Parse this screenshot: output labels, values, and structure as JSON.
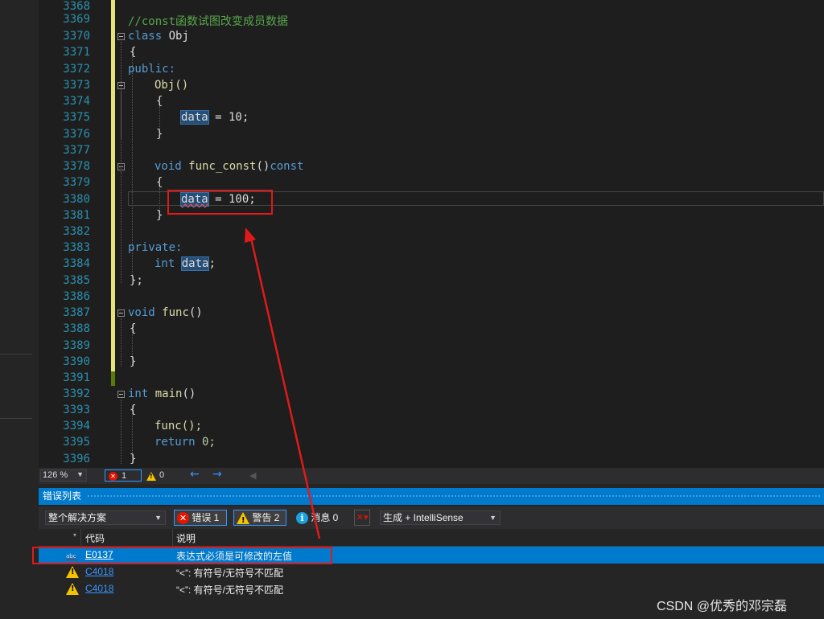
{
  "editor": {
    "lines": [
      {
        "n": "3368"
      },
      {
        "n": "3369"
      },
      {
        "n": "3370"
      },
      {
        "n": "3371"
      },
      {
        "n": "3372"
      },
      {
        "n": "3373"
      },
      {
        "n": "3374"
      },
      {
        "n": "3375"
      },
      {
        "n": "3376"
      },
      {
        "n": "3377"
      },
      {
        "n": "3378"
      },
      {
        "n": "3379"
      },
      {
        "n": "3380"
      },
      {
        "n": "3381"
      },
      {
        "n": "3382"
      },
      {
        "n": "3383"
      },
      {
        "n": "3384"
      },
      {
        "n": "3385"
      },
      {
        "n": "3386"
      },
      {
        "n": "3387"
      },
      {
        "n": "3388"
      },
      {
        "n": "3389"
      },
      {
        "n": "3390"
      },
      {
        "n": "3391"
      },
      {
        "n": "3392"
      },
      {
        "n": "3393"
      },
      {
        "n": "3394"
      },
      {
        "n": "3395"
      },
      {
        "n": "3396"
      }
    ],
    "code": {
      "comment": "//const函数试图改变成员数据",
      "class_kw": "class",
      "class_name": "Obj",
      "open_brace": "{",
      "close_brace": "}",
      "class_end": "};",
      "public_label": "public:",
      "private_label": "private:",
      "ctor": "Obj()",
      "data_ident": "data",
      "assign_10": " = 10;",
      "void_kw": "void",
      "func_const_name": "func_const",
      "parens": "()",
      "const_kw": "const",
      "assign_100": " = 100;",
      "int_kw": "int",
      "semicolon": ";",
      "func_name": "func",
      "main_name": "main",
      "func_call": "func();",
      "return_kw": "return",
      "return_val": " 0;"
    }
  },
  "statusbar": {
    "zoom": "126 %",
    "error_count": "1",
    "warning_count": "0"
  },
  "error_list": {
    "title": "错误列表",
    "scope": "整个解决方案",
    "errors_btn": "错误 1",
    "warnings_btn": "警告 2",
    "messages_btn": "消息 0",
    "build_filter": "生成 + IntelliSense",
    "col_code": "代码",
    "col_desc": "说明",
    "rows": [
      {
        "code": "E0137",
        "desc": "表达式必须是可修改的左值",
        "kind": "intellisense-error"
      },
      {
        "code": "C4018",
        "desc": "“<”: 有符号/无符号不匹配",
        "kind": "warning"
      },
      {
        "code": "C4018",
        "desc": "“<”: 有符号/无符号不匹配",
        "kind": "warning"
      }
    ]
  },
  "watermark": "CSDN @优秀的邓宗磊",
  "colors": {
    "background": "#1e1e1e",
    "keyword": "#569cd6",
    "comment": "#57a64a",
    "number": "#b5cea8",
    "line_number": "#2b91af",
    "selection": "#007acc",
    "annotation_red": "#e01a1a"
  }
}
